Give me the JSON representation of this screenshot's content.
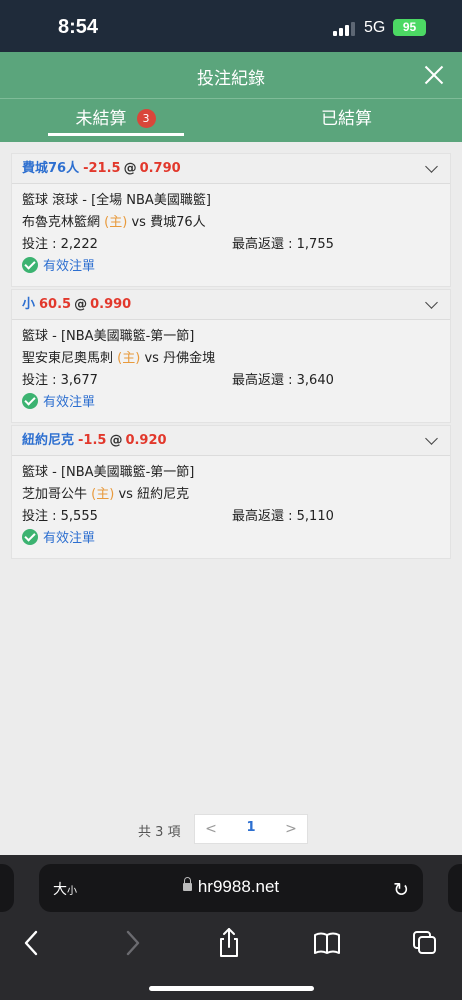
{
  "status_bar": {
    "time": "8:54",
    "network": "5G",
    "battery": "95"
  },
  "header": {
    "title": "投注紀錄"
  },
  "tabs": {
    "unsettled_label": "未結算",
    "unsettled_count": "3",
    "settled_label": "已結算"
  },
  "bets": [
    {
      "team": "費城76人",
      "line": "-21.5",
      "at": "@",
      "odds": "0.790",
      "league": "籃球 滾球 - [全場 NBA美國職籃]",
      "home_team": "布魯克林籃網",
      "home_tag": "(主)",
      "vs": "vs",
      "away_team": "費城76人",
      "stake": "投注 : 2,222",
      "max_return": "最高返還 : 1,755",
      "status": "有效注單"
    },
    {
      "team": "小",
      "line": "60.5",
      "at": "@",
      "odds": "0.990",
      "league": "籃球 - [NBA美國職籃-第一節]",
      "home_team": "聖安東尼奧馬刺",
      "home_tag": "(主)",
      "vs": "vs",
      "away_team": "丹佛金塊",
      "stake": "投注 : 3,677",
      "max_return": "最高返還 : 3,640",
      "status": "有效注單"
    },
    {
      "team": "紐約尼克",
      "line": "-1.5",
      "at": "@",
      "odds": "0.920",
      "league": "籃球 - [NBA美國職籃-第一節]",
      "home_team": "芝加哥公牛",
      "home_tag": "(主)",
      "vs": "vs",
      "away_team": "紐約尼克",
      "stake": "投注 : 5,555",
      "max_return": "最高返還 : 5,110",
      "status": "有效注單"
    }
  ],
  "pagination": {
    "total": "共 3 項",
    "prev": "<",
    "current": "1",
    "next": ">"
  },
  "browser": {
    "text_size_big": "大",
    "text_size_small": "小",
    "url": "hr9988.net",
    "reload": "↻"
  },
  "colors": {
    "header_green": "#5ba57c",
    "team_blue": "#2d6fd0",
    "odds_red": "#e2382c",
    "home_orange": "#e89a3c",
    "badge_red": "#d9463a",
    "check_green": "#3cb371"
  },
  "icons": [
    "close-icon",
    "chevron-down-icon",
    "check-circle-icon",
    "lock-icon",
    "reload-icon",
    "back-icon",
    "forward-icon",
    "share-icon",
    "bookmarks-icon",
    "tabs-icon"
  ]
}
